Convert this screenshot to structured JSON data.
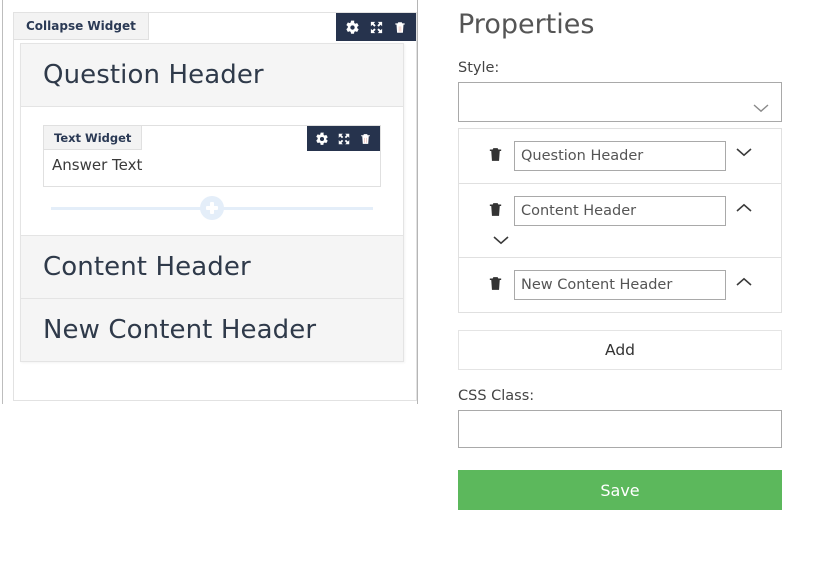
{
  "canvas": {
    "widget": {
      "tab_label": "Collapse Widget",
      "tools": [
        {
          "name": "gear-icon",
          "title": "Settings"
        },
        {
          "name": "move-icon",
          "title": "Move"
        },
        {
          "name": "trash-icon",
          "title": "Delete"
        }
      ]
    },
    "sections": [
      {
        "type": "header",
        "label": "Question Header"
      },
      {
        "type": "panel"
      },
      {
        "type": "header",
        "label": "Content Header"
      },
      {
        "type": "header",
        "label": "New Content Header"
      }
    ],
    "text_widget": {
      "tab_label": "Text Widget",
      "content": "Answer Text",
      "tools": [
        {
          "name": "gear-icon",
          "title": "Settings"
        },
        {
          "name": "move-icon",
          "title": "Move"
        },
        {
          "name": "trash-icon",
          "title": "Delete"
        }
      ]
    },
    "add_divider": {
      "name": "add-widget-button",
      "label": "+"
    }
  },
  "properties": {
    "title": "Properties",
    "style_label": "Style:",
    "style_value": "",
    "style_placeholder": "",
    "headers": [
      {
        "value": "Question Header",
        "chevron": "down",
        "extra_chevron": null
      },
      {
        "value": "Content Header",
        "chevron": "up",
        "extra_chevron": "down"
      },
      {
        "value": "New Content Header",
        "chevron": "up",
        "extra_chevron": null
      }
    ],
    "add_label": "Add",
    "css_class_label": "CSS Class:",
    "css_class_value": "",
    "save_label": "Save"
  },
  "colors": {
    "toolbar_bg": "#26334d",
    "tab_bg": "#f3f3f3",
    "header_bg": "#f5f5f5",
    "save_green": "#5cb85c",
    "add_divider_blue": "#e4eef9",
    "border_gray": "#e0e0e0",
    "input_border": "#a9a9a9"
  }
}
